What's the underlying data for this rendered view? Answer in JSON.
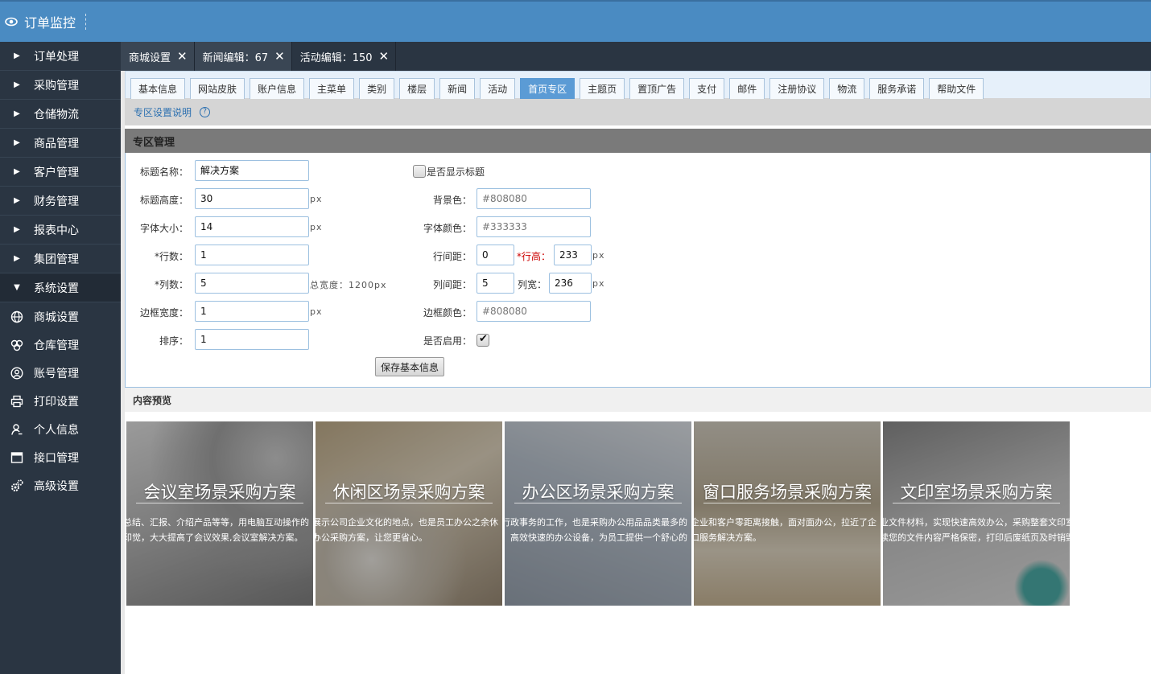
{
  "header": {
    "title": "订单监控"
  },
  "sidebar": {
    "menus": [
      {
        "label": "订单处理",
        "open": false
      },
      {
        "label": "采购管理",
        "open": false
      },
      {
        "label": "仓储物流",
        "open": false
      },
      {
        "label": "商品管理",
        "open": false
      },
      {
        "label": "客户管理",
        "open": false
      },
      {
        "label": "财务管理",
        "open": false
      },
      {
        "label": "报表中心",
        "open": false
      },
      {
        "label": "集团管理",
        "open": false
      },
      {
        "label": "系统设置",
        "open": true
      }
    ],
    "sub_items": [
      {
        "label": "商城设置",
        "icon": "globe-icon"
      },
      {
        "label": "仓库管理",
        "icon": "warehouse-icon"
      },
      {
        "label": "账号管理",
        "icon": "user-circle-icon"
      },
      {
        "label": "打印设置",
        "icon": "printer-icon"
      },
      {
        "label": "个人信息",
        "icon": "person-icon"
      },
      {
        "label": "接口管理",
        "icon": "window-icon"
      },
      {
        "label": "高级设置",
        "icon": "gears-icon"
      }
    ]
  },
  "tabs": [
    {
      "label": "商城设置",
      "active": false
    },
    {
      "label": "新闻编辑：67",
      "active": false
    },
    {
      "label": "活动编辑：150",
      "active": true
    }
  ],
  "subtabs": [
    "基本信息",
    "网站皮肤",
    "账户信息",
    "主菜单",
    "类别",
    "楼层",
    "新闻",
    "活动",
    "首页专区",
    "主题页",
    "置顶广告",
    "支付",
    "邮件",
    "注册协议",
    "物流",
    "服务承诺",
    "帮助文件"
  ],
  "subtab_active": "首页专区",
  "explain": {
    "link": "专区设置说明"
  },
  "panel": {
    "title": "专区管理"
  },
  "form": {
    "title_name_label": "标题名称：",
    "title_name": "解决方案",
    "show_title_label": "是否显示标题",
    "title_height_label": "标题高度：",
    "title_height": "30",
    "bg_color_label": "背景色：",
    "bg_color": "#808080",
    "font_size_label": "字体大小：",
    "font_size": "14",
    "font_color_label": "字体颜色：",
    "font_color": "#333333",
    "rows_label": "*行数：",
    "rows": "1",
    "row_gap_label": "行间距：",
    "row_gap": "0",
    "row_height_label": "*行高：",
    "row_height": "233",
    "cols_label": "*列数：",
    "cols": "5",
    "total_width": "总宽度：1200px",
    "col_gap_label": "列间距：",
    "col_gap": "5",
    "col_width_label": "列宽：",
    "col_width": "236",
    "border_width_label": "边框宽度：",
    "border_width": "1",
    "border_color_label": "边框颜色：",
    "border_color": "#808080",
    "sort_label": "排序：",
    "sort": "1",
    "enabled_label": "是否启用：",
    "enabled": true,
    "unit_px": "px",
    "save_label": "保存基本信息"
  },
  "preview": {
    "title": "内容预览",
    "cards": [
      {
        "title": "会议室场景采购方案",
        "desc1": "总结、汇报、介绍产品等等，用电脑互动操作的",
        "desc2": "印觉，大大提高了会议效果,会议室解决方案。"
      },
      {
        "title": "休闲区场景采购方案",
        "desc1": "展示公司企业文化的地点，也是员工办公之余休",
        "desc2": "办公采购方案，让您更省心。"
      },
      {
        "title": "办公区场景采购方案",
        "desc1": "行政事务的工作，也是采购办公用品品类最多的",
        "desc2": "，高效快速的办公设备，为员工提供一个舒心的"
      },
      {
        "title": "窗口服务场景采购方案",
        "desc1": "企业和客户零距离接触，面对面办公，拉近了企",
        "desc2": "口服务解决方案。"
      },
      {
        "title": "文印室场景采购方案",
        "desc1": "业文件材料，实现快速高效办公，采购整套文印室产",
        "desc2": "读您的文件内容严格保密，打印后废纸页及时销毁"
      }
    ]
  }
}
